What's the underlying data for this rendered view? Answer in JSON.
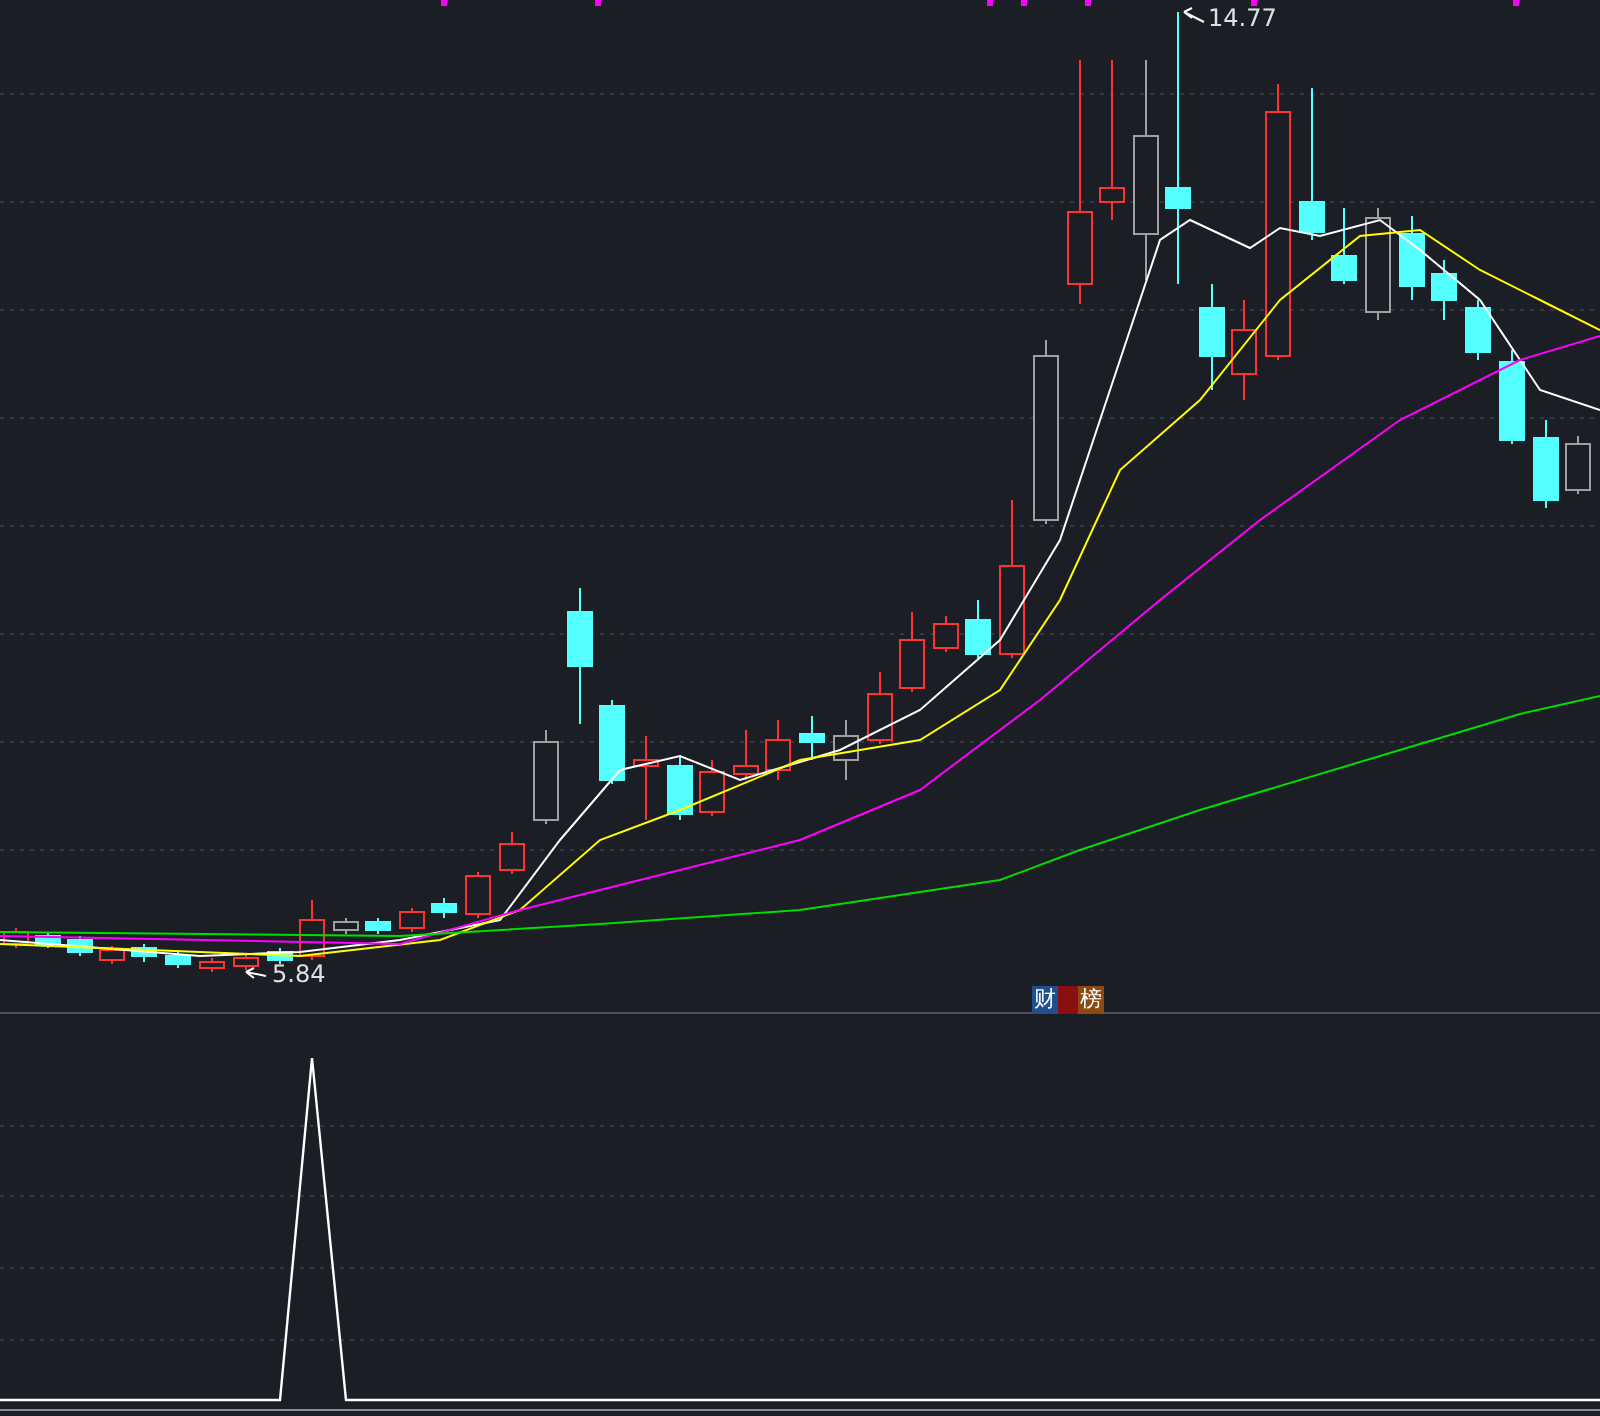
{
  "main_pane": {
    "high_marker": "14.77",
    "low_marker": "5.84"
  },
  "indicator_pane": {
    "title_segments": [
      {
        "text": "财",
        "color": "#1f4f8f"
      },
      {
        "text": "榜",
        "color": "#8c4a12"
      }
    ]
  }
}
